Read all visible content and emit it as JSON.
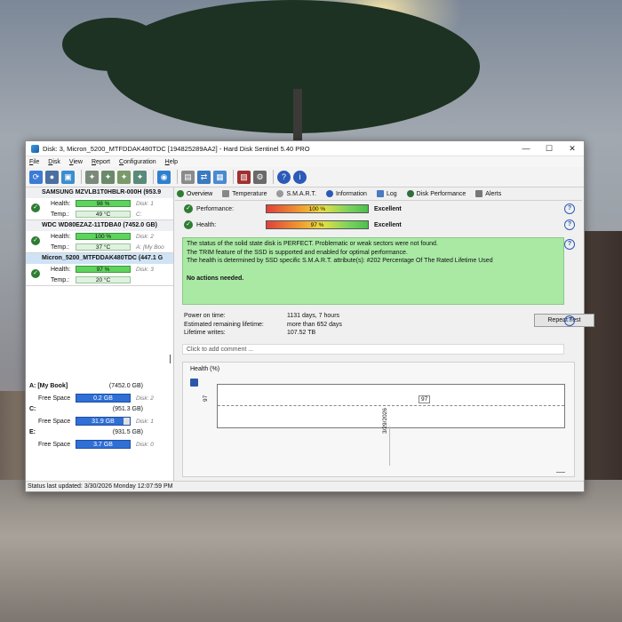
{
  "window": {
    "title": "Disk: 3, Micron_5200_MTFDDAK480TDC [194825289AA2]  -  Hard Disk Sentinel 5.40 PRO",
    "minimize": "—",
    "maximize": "☐",
    "close": "✕"
  },
  "menu": [
    "File",
    "Disk",
    "View",
    "Report",
    "Configuration",
    "Help"
  ],
  "disks": [
    {
      "name": "SAMSUNG MZVLB1T0HBLR-000H (953.9",
      "health_label": "Health:",
      "health": "98 %",
      "temp_label": "Temp.:",
      "temp": "49 °C",
      "side1": "Disk: 1",
      "side2": "C:"
    },
    {
      "name": "WDC WD80EZAZ-11TDBA0 (7452.0 GB)",
      "health_label": "Health:",
      "health": "100 %",
      "temp_label": "Temp.:",
      "temp": "37 °C",
      "side1": "Disk: 2",
      "side2": "A: [My Boo"
    },
    {
      "name": "Micron_5200_MTFDDAK480TDC (447.1 G",
      "health_label": "Health:",
      "health": "97 %",
      "temp_label": "Temp.:",
      "temp": "20 °C",
      "side1": "Disk: 3",
      "side2": ""
    }
  ],
  "volumes": [
    {
      "name": "A: [My Book]",
      "size": "(7452.0 GB)",
      "label": "Free Space",
      "free": "0.2 GB",
      "disk": "Disk: 2"
    },
    {
      "name": "C:",
      "size": "(951.3 GB)",
      "label": "Free Space",
      "free": "31.9 GB",
      "disk": "Disk: 1"
    },
    {
      "name": "E:",
      "size": "(931.5 GB)",
      "label": "Free Space",
      "free": "3.7 GB",
      "disk": "Disk: 0"
    }
  ],
  "tabs": [
    "Overview",
    "Temperature",
    "S.M.A.R.T.",
    "Information",
    "Log",
    "Disk Performance",
    "Alerts"
  ],
  "performance": {
    "label": "Performance:",
    "value": "100 %",
    "rating": "Excellent"
  },
  "health": {
    "label": "Health:",
    "value": "97 %",
    "rating": "Excellent"
  },
  "status_text": {
    "line1": "The status of the solid state disk is PERFECT. Problematic or weak sectors were not found.",
    "line2": "The TRIM feature of the SSD is supported and enabled for optimal performance.",
    "line3": "The health is determined by SSD specific S.M.A.R.T. attribute(s):  #202 Percentage Of The Rated Lifetime Used",
    "actions": "No actions needed."
  },
  "info": {
    "power_on_label": "Power on time:",
    "power_on": "1131 days, 7 hours",
    "remaining_label": "Estimated remaining lifetime:",
    "remaining": "more than 652 days",
    "writes_label": "Lifetime writes:",
    "writes": "107.52 TB"
  },
  "repeat_test": "Repeat Test",
  "comment_placeholder": "Click to add comment ...",
  "chart_data": {
    "type": "line",
    "title": "Health (%)",
    "x": [
      "3/29/2026"
    ],
    "series": [
      {
        "values": [
          97
        ]
      }
    ],
    "ytick": "97",
    "point_label": "97"
  },
  "statusbar": "Status last updated: 3/30/2026 Monday 12:07:59 PM"
}
